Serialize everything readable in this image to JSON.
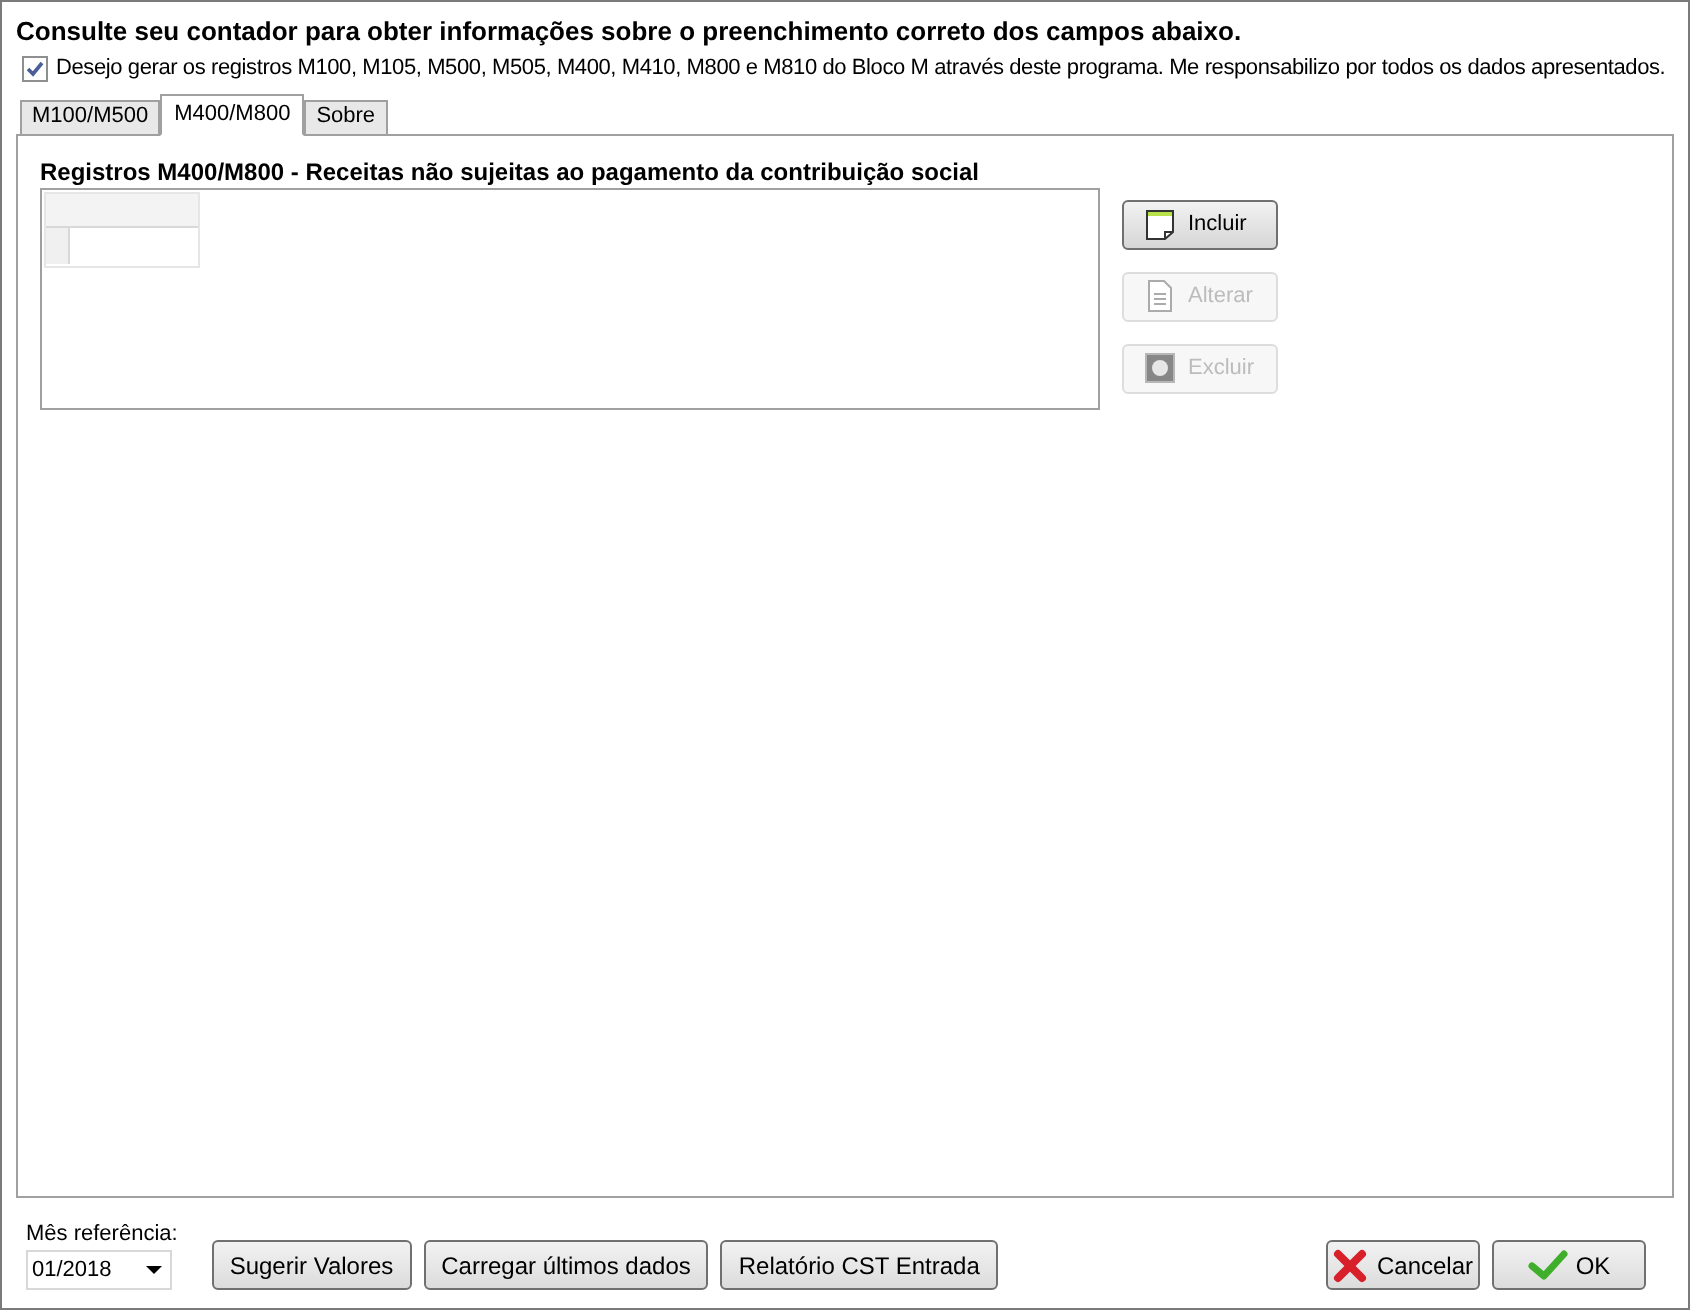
{
  "notice": "Consulte seu contador para obter informações sobre o preenchimento correto dos campos abaixo.",
  "consent": {
    "label": "Desejo gerar os registros M100, M105, M500, M505, M400, M410, M800 e M810 do Bloco M através deste programa. Me responsabilizo por todos os dados apresentados.",
    "checked": true
  },
  "tabs": [
    {
      "label": "M100/M500",
      "selected": false
    },
    {
      "label": "M400/M800",
      "selected": true
    },
    {
      "label": "Sobre",
      "selected": false
    }
  ],
  "group_title": "Registros M400/M800 - Receitas não sujeitas ao pagamento da contribuição social",
  "actions": [
    {
      "label": "Incluir",
      "kind": "add",
      "disabled": false
    },
    {
      "label": "Alterar",
      "kind": "edit",
      "disabled": true
    },
    {
      "label": "Excluir",
      "kind": "delete",
      "disabled": true
    }
  ],
  "month": {
    "label": "Mês referência:",
    "value": "01/2018"
  },
  "footer_buttons": [
    {
      "label": "Sugerir Valores",
      "kind": "plain"
    },
    {
      "label": "Carregar últimos dados",
      "kind": "plain"
    },
    {
      "label": "Relatório CST Entrada",
      "kind": "plain"
    },
    {
      "label": "Cancelar",
      "kind": "cancel"
    },
    {
      "label": "OK",
      "kind": "ok"
    }
  ]
}
